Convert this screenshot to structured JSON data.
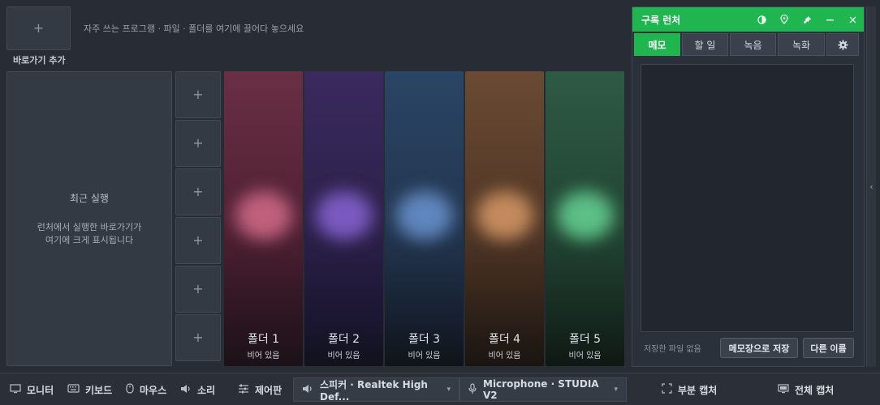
{
  "quick_add": {
    "icon": "plus-icon",
    "hint": "자주 쓰는 프로그램 · 파일 · 폴더를 여기에 끌어다 놓으세요",
    "label": "바로가기 추가"
  },
  "recent": {
    "title": "최근 실행",
    "desc_line1": "런처에서 실행한 바로가기가",
    "desc_line2": "여기에 크게 표시됩니다"
  },
  "slots": {
    "count": 6,
    "icon": "plus-icon"
  },
  "folders": [
    {
      "name": "폴더 1",
      "status": "비어 있음",
      "color": "#c0607d"
    },
    {
      "name": "폴더 2",
      "status": "비어 있음",
      "color": "#7a5ac0"
    },
    {
      "name": "폴더 3",
      "status": "비어 있음",
      "color": "#5f86bd"
    },
    {
      "name": "폴더 4",
      "status": "비어 있음",
      "color": "#c48a5d"
    },
    {
      "name": "폴더 5",
      "status": "비어 있음",
      "color": "#5cbf85"
    }
  ],
  "panel": {
    "title": "구록 런처",
    "accent": "#1fb64f",
    "header_icons": [
      "contrast-icon",
      "location-pin-icon",
      "pin-icon",
      "minimize-icon",
      "close-icon"
    ],
    "tabs": [
      {
        "label": "메모",
        "active": true
      },
      {
        "label": "할 일",
        "active": false
      },
      {
        "label": "녹음",
        "active": false
      },
      {
        "label": "녹화",
        "active": false
      }
    ],
    "settings_icon": "gear-icon",
    "memo_value": "",
    "saved_status": "저장한 파일 없음",
    "save_button": "메모장으로 저장",
    "save_as_button": "다른 이름"
  },
  "bottombar": {
    "items": [
      {
        "icon": "monitor-icon",
        "label": "모니터"
      },
      {
        "icon": "keyboard-icon",
        "label": "키보드"
      },
      {
        "icon": "mouse-icon",
        "label": "마우스"
      },
      {
        "icon": "speaker-icon",
        "label": "소리"
      },
      {
        "icon": "sliders-icon",
        "label": "제어판"
      }
    ],
    "speaker_device": "스피커 · Realtek High Def...",
    "mic_device": "Microphone · STUDIA V2",
    "partial_capture": "부분 캡처",
    "full_capture": "전체 캡처"
  }
}
